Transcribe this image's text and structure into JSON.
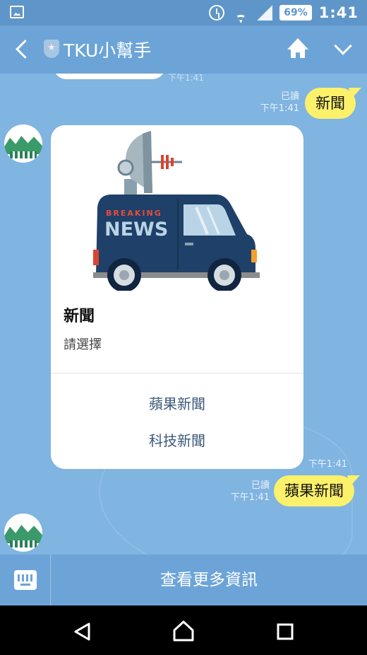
{
  "status_bar": {
    "battery": "69%",
    "time": "1:41",
    "icons": [
      "image-icon",
      "alarm-icon",
      "wifi-icon",
      "signal-icon",
      "battery-icon"
    ]
  },
  "header": {
    "title": "TKU小幫手",
    "icons": [
      "back-icon",
      "shield-icon",
      "home-icon",
      "chevron-down-icon"
    ]
  },
  "chat": {
    "previous_time": "下午1:41",
    "messages": [
      {
        "sender": "user",
        "text": "新聞",
        "read": "已讀",
        "time": "下午1:41"
      },
      {
        "sender": "bot",
        "card": {
          "image_text": "BREAKING NEWS",
          "title": "新聞",
          "subtitle": "請選擇",
          "actions": [
            "蘋果新聞",
            "科技新聞"
          ]
        },
        "time": "下午1:41"
      },
      {
        "sender": "user",
        "text": "蘋果新聞",
        "read": "已讀",
        "time": "下午1:41"
      }
    ]
  },
  "bottom_bar": {
    "more_info": "查看更多資訊"
  },
  "colors": {
    "header": "#6ca4d8",
    "chat_bg": "#80b4e1",
    "user_bubble": "#fbf16b",
    "card_action": "#3d5a7a"
  }
}
